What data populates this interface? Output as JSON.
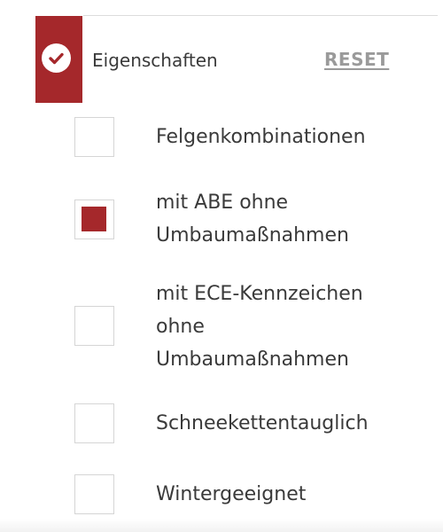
{
  "filter": {
    "title": "Eigenschaften",
    "reset_label": "RESET",
    "accent_color": "#a5282b",
    "header_icon": "check-icon",
    "options": [
      {
        "label": "Felgenkombinationen",
        "checked": false
      },
      {
        "label": "mit ABE ohne Umbaumaßnahmen",
        "checked": true
      },
      {
        "label": "mit ECE-Kennzeichen ohne Umbaumaßnahmen",
        "checked": false
      },
      {
        "label": "Schneekettentauglich",
        "checked": false
      },
      {
        "label": "Wintergeeignet",
        "checked": false
      }
    ]
  }
}
